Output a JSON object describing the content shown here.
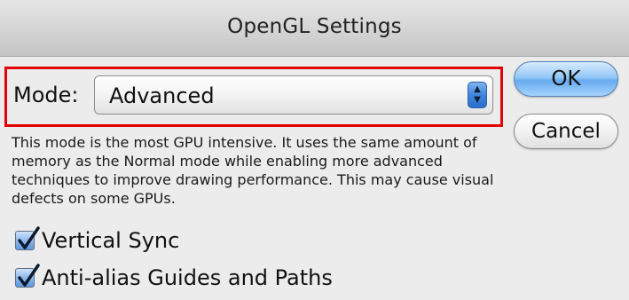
{
  "dialog": {
    "title": "OpenGL Settings"
  },
  "mode": {
    "label": "Mode:",
    "selected": "Advanced",
    "description": "This mode is the most GPU intensive.  It uses the same amount of memory as the Normal mode while enabling more advanced techniques to improve drawing performance.  This may cause visual defects on some GPUs."
  },
  "buttons": {
    "ok": "OK",
    "cancel": "Cancel"
  },
  "options": {
    "vertical_sync": {
      "label": "Vertical Sync",
      "checked": true
    },
    "anti_alias": {
      "label": "Anti-alias Guides and Paths",
      "checked": true
    }
  },
  "colors": {
    "highlight": "#e30000",
    "default_button": "#66aaf0",
    "window_bg": "#ececec"
  },
  "icons": {
    "select_arrows": "up-down-arrows-icon",
    "checkmark": "checkmark-icon"
  }
}
